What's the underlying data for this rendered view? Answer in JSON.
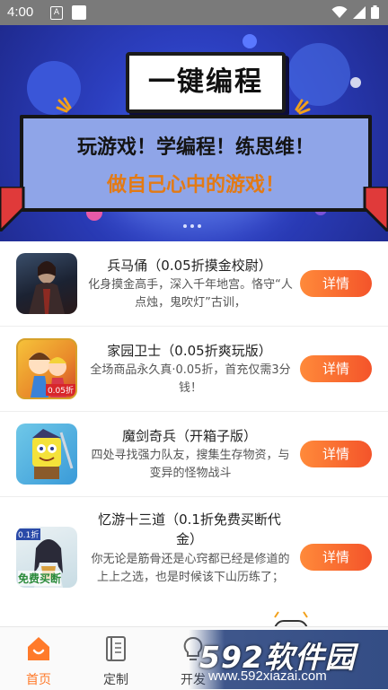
{
  "status_bar": {
    "time": "4:00",
    "a_badge": "A"
  },
  "banner": {
    "title": "一键编程",
    "line1": "玩游戏！学编程！练思维！",
    "line2": "做自己心中的游戏！",
    "page_indicator_count": 3
  },
  "games": [
    {
      "name": "兵马俑（0.05折摸金校尉）",
      "desc": "化身摸金高手，深入千年地宫。恪守“人点烛，鬼吹灯”古训，",
      "button": "详情",
      "icon": "warrior-game-icon"
    },
    {
      "name": "家园卫士（0.05折爽玩版）",
      "desc": "全场商品永久真·0.05折，首充仅需3分钱！",
      "button": "详情",
      "icon": "hero-girls-game-icon",
      "badge": "0.05折"
    },
    {
      "name": "魔剑奇兵（开箱子版）",
      "desc": "四处寻找强力队友，搜集生存物资，与变异的怪物战斗",
      "button": "详情",
      "icon": "sponge-knight-game-icon"
    },
    {
      "name": "忆游十三道（0.1折免费买断代金）",
      "desc": "你无论是筋骨还是心窍都已经是修道的上上之选，也是时候该下山历练了；",
      "button": "详情",
      "icon": "xianxia-girl-game-icon",
      "badge_top": "0.1折",
      "badge_bottom": "免费买断"
    }
  ],
  "nav": {
    "items": [
      {
        "label": "首页",
        "icon": "home-icon",
        "active": true
      },
      {
        "label": "定制",
        "icon": "book-icon",
        "active": false
      },
      {
        "label": "开发",
        "icon": "bulb-icon",
        "active": false
      }
    ]
  },
  "watermark": {
    "main": "592软件园",
    "url": "www.592xiazai.com"
  },
  "colors": {
    "accent": "#ff7a2a",
    "button_start": "#ff8a3a",
    "button_end": "#f4542a",
    "banner_blue": "#2c3fc0"
  }
}
